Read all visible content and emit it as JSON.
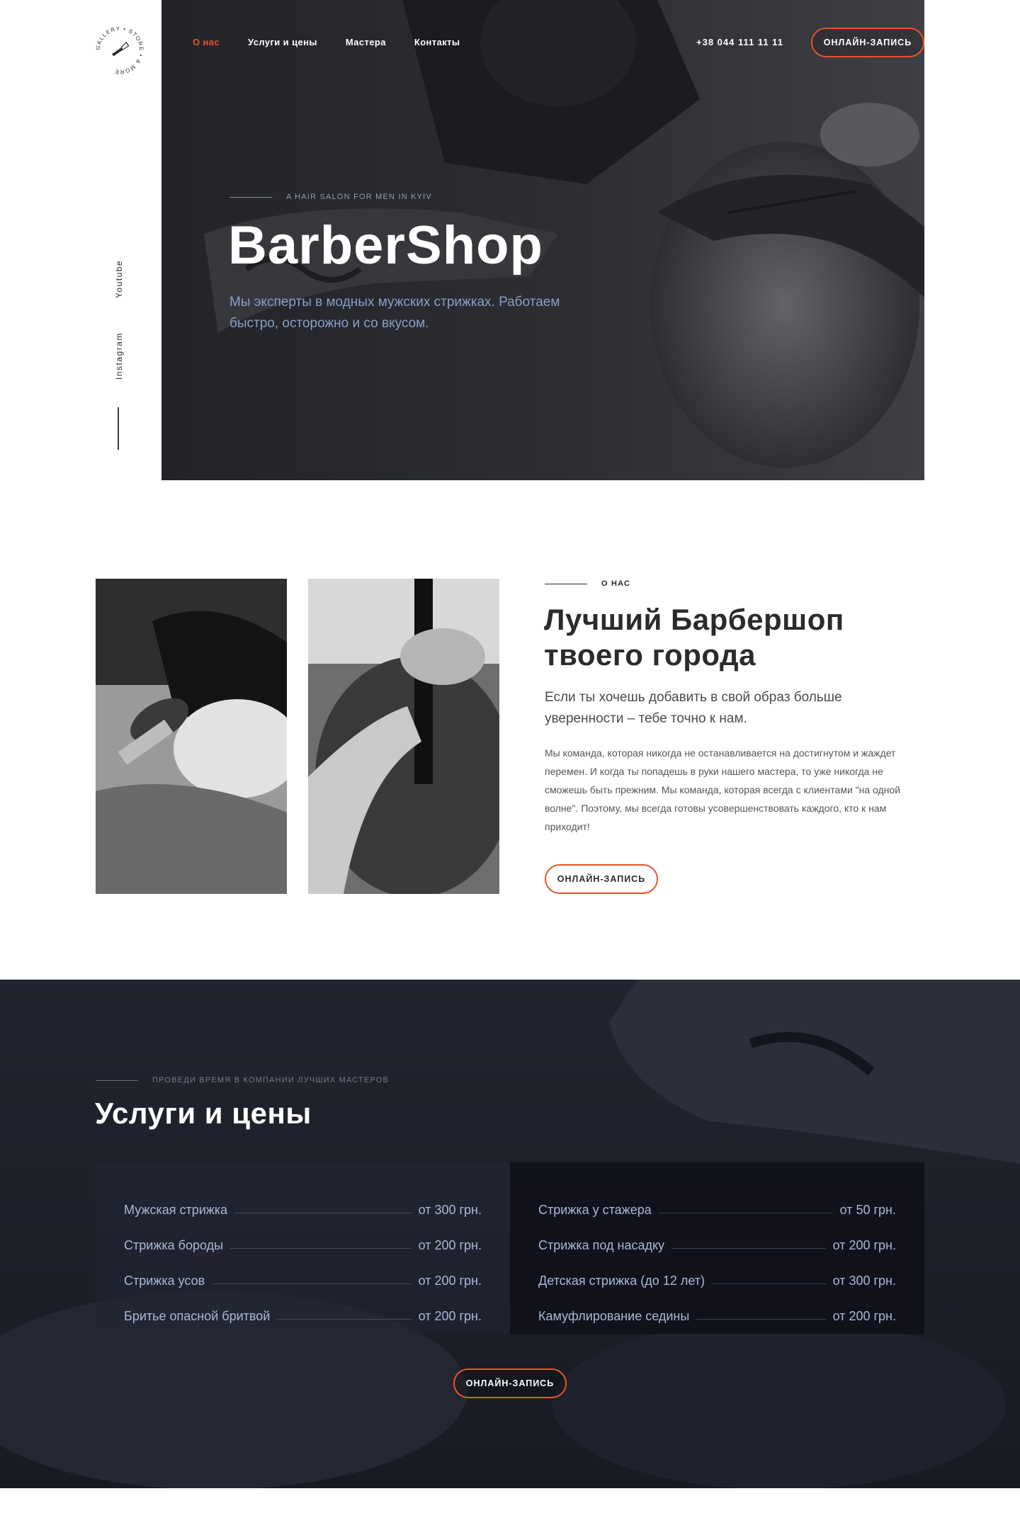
{
  "logo": {
    "ring_text": "GALLERY • STORE • & MORE"
  },
  "social": {
    "youtube": "Youtube",
    "instagram": "Instagram"
  },
  "nav": {
    "items": [
      "О нас",
      "Услуги и цены",
      "Мастера",
      "Контакты"
    ],
    "active_color": "#e8542a"
  },
  "header": {
    "phone": "+38 044 111 11 11",
    "cta": "ОНЛАЙН-ЗАПИСЬ"
  },
  "hero": {
    "kicker": "A HAIR SALON FOR MEN IN KYIV",
    "title": "BarberShop",
    "subtitle": "Мы эксперты в модных мужских стрижках. Работаем быстро, осторожно и со вкусом."
  },
  "about": {
    "kicker": "О НАС",
    "title": "Лучший Барбершоп твоего города",
    "lead": "Если ты хочешь добавить в свой образ больше уверенности – тебе точно к нам.",
    "text": "Мы команда, которая никогда не останавливается на достигнутом и жаждет перемен. И когда ты попадешь в руки нашего мастера, то уже никогда не сможешь быть прежним. Мы команда, которая всегда с клиентами \"на одной волне\". Поэтому, мы всегда готовы усовершенствовать каждого, кто к нам приходит!",
    "cta": "ОНЛАЙН-ЗАПИСЬ"
  },
  "services": {
    "kicker": "ПРОВЕДИ ВРЕМЯ В КОМПАНИИ ЛУЧШИХ МАСТЕРОВ",
    "title": "Услуги и цены",
    "left": [
      {
        "name": "Мужская стрижка",
        "price": "от 300 грн."
      },
      {
        "name": "Стрижка бороды",
        "price": "от 200 грн."
      },
      {
        "name": "Стрижка усов",
        "price": "от 200 грн."
      },
      {
        "name": "Бритье опасной бритвой",
        "price": "от 200 грн."
      }
    ],
    "right": [
      {
        "name": "Стрижка у стажера",
        "price": "от 50 грн."
      },
      {
        "name": "Стрижка под насадку",
        "price": "от 200 грн."
      },
      {
        "name": "Детская стрижка (до 12 лет)",
        "price": "от 300 грн."
      },
      {
        "name": "Камуфлирование седины",
        "price": "от 200 грн."
      }
    ],
    "cta": "ОНЛАЙН-ЗАПИСЬ"
  },
  "colors": {
    "accent": "#e8542a",
    "dark_bg": "#22252f",
    "price_text": "#aab8d6"
  }
}
